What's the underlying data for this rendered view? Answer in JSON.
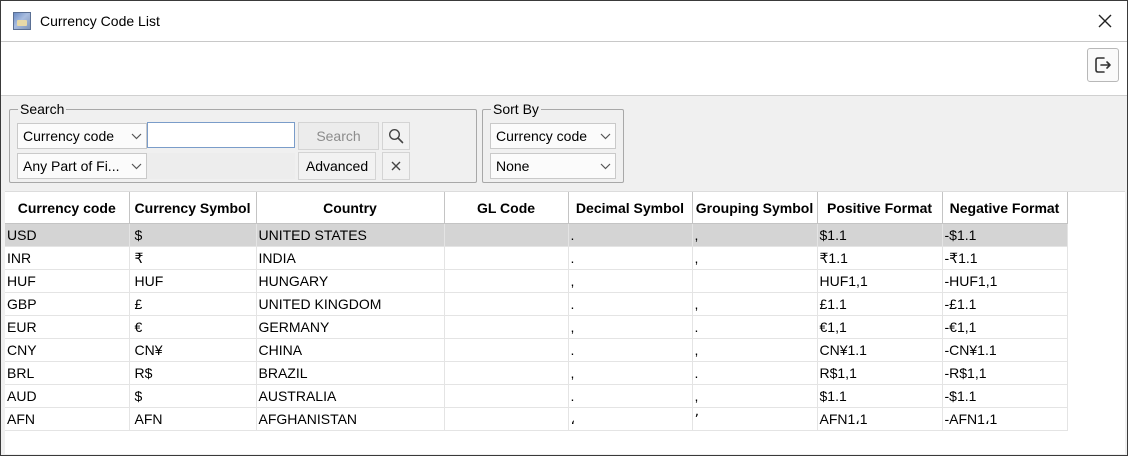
{
  "window": {
    "title": "Currency Code List"
  },
  "search": {
    "legend": "Search",
    "field_select": "Currency code",
    "match_select": "Any Part of Fi...",
    "input_value": "",
    "search_button": "Search",
    "advanced_button": "Advanced"
  },
  "sort": {
    "legend": "Sort By",
    "primary": "Currency code",
    "secondary": "None"
  },
  "table": {
    "columns": [
      "Currency code",
      "Currency Symbol",
      "Country",
      "GL Code",
      "Decimal Symbol",
      "Grouping Symbol",
      "Positive Format",
      "Negative Format"
    ],
    "rows": [
      [
        "USD",
        "$",
        "UNITED STATES",
        "",
        ".",
        ",",
        "$1.1",
        "-$1.1"
      ],
      [
        "INR",
        "₹",
        "INDIA",
        "",
        ".",
        ",",
        "₹1.1",
        "-₹1.1"
      ],
      [
        "HUF",
        "HUF",
        "HUNGARY",
        "",
        ",",
        "",
        "HUF1,1",
        "-HUF1,1"
      ],
      [
        "GBP",
        "£",
        "UNITED KINGDOM",
        "",
        ".",
        ",",
        "£1.1",
        "-£1.1"
      ],
      [
        "EUR",
        "€",
        "GERMANY",
        "",
        ",",
        ".",
        "€1,1",
        "-€1,1"
      ],
      [
        "CNY",
        "CN¥",
        "CHINA",
        "",
        ".",
        ",",
        "CN¥1.1",
        "-CN¥1.1"
      ],
      [
        "BRL",
        "R$",
        "BRAZIL",
        "",
        ",",
        ".",
        "R$1,1",
        "-R$1,1"
      ],
      [
        "AUD",
        "$",
        "AUSTRALIA",
        "",
        ".",
        ",",
        "$1.1",
        "-$1.1"
      ],
      [
        "AFN",
        "AFN",
        "AFGHANISTAN",
        "",
        "،",
        "٬",
        "AFN1،1",
        "-AFN1،1"
      ]
    ],
    "selected_row": 0
  },
  "icons": {
    "app": "currency-list-app-icon",
    "close": "close-icon",
    "exit": "exit-icon",
    "search": "search-icon",
    "clear": "clear-icon",
    "chevron": "chevron-down-icon"
  }
}
